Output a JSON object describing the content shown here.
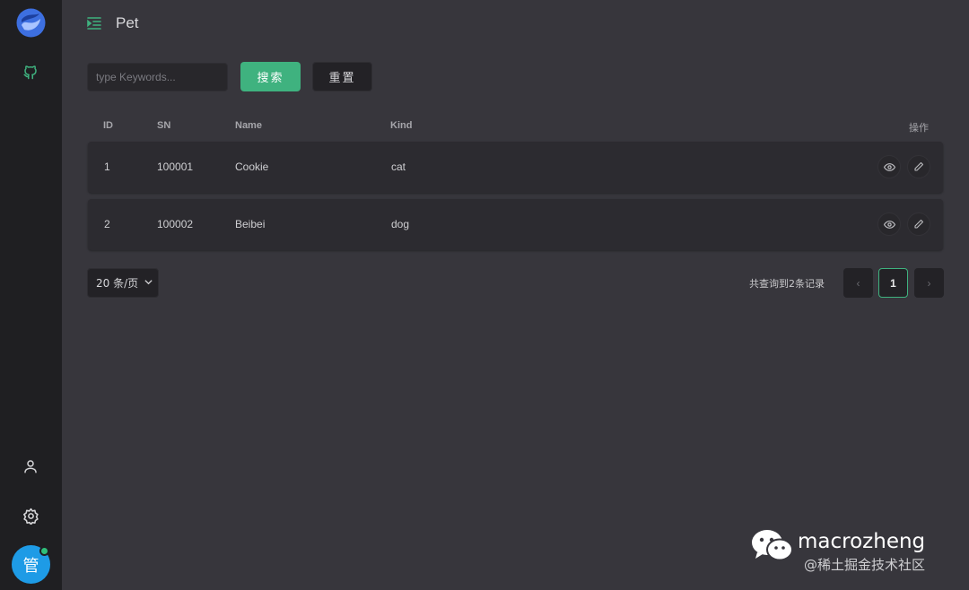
{
  "header": {
    "title": "Pet",
    "menu_icon": "menu-fold-icon"
  },
  "sidebar": {
    "logo": "brand-logo",
    "items": [
      {
        "icon": "github-icon",
        "active": true
      },
      {
        "icon": "user-icon"
      },
      {
        "icon": "gear-icon"
      }
    ],
    "avatar_text": "管",
    "avatar_color": "#1e9be6",
    "status_color": "#2fbf7a"
  },
  "search": {
    "placeholder": "type Keywords...",
    "value": "",
    "search_label": "搜索",
    "reset_label": "重置"
  },
  "table": {
    "columns": {
      "id": "ID",
      "sn": "SN",
      "name": "Name",
      "kind": "Kind",
      "actions": "操作"
    },
    "rows": [
      {
        "id": "1",
        "sn": "100001",
        "name": "Cookie",
        "kind": "cat"
      },
      {
        "id": "2",
        "sn": "100002",
        "name": "Beibei",
        "kind": "dog"
      }
    ]
  },
  "pagination": {
    "page_size_label": "20 条/页",
    "total_text": "共查询到2条记录",
    "current_page": "1",
    "prev_glyph": "‹",
    "next_glyph": "›"
  },
  "watermark": {
    "name": "macrozheng",
    "subtitle": "@稀土掘金技术社区"
  },
  "colors": {
    "accent": "#3fb27f",
    "background": "#37363c",
    "sidebar": "#1f1f22"
  }
}
